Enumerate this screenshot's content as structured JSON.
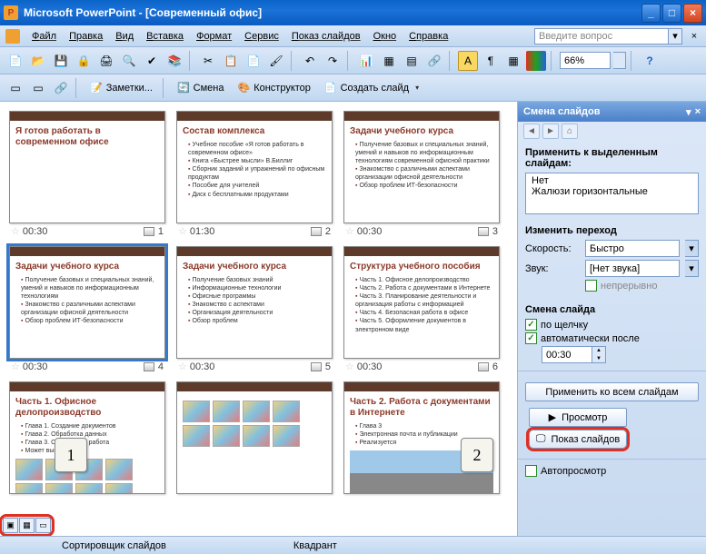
{
  "titlebar": {
    "text": "Microsoft PowerPoint - [Современный офис]"
  },
  "menu": {
    "items": [
      "Файл",
      "Правка",
      "Вид",
      "Вставка",
      "Формат",
      "Сервис",
      "Показ слайдов",
      "Окно",
      "Справка"
    ],
    "askbox_placeholder": "Введите вопрос"
  },
  "toolbar": {
    "zoom": "66%"
  },
  "toolbar2": {
    "notes": "Заметки...",
    "transition": "Смена",
    "design": "Конструктор",
    "newslide": "Создать слайд"
  },
  "slides": [
    {
      "time": "00:30",
      "num": "1",
      "title": "Я готов работать в современном офисе",
      "bullets": []
    },
    {
      "time": "01:30",
      "num": "2",
      "title": "Состав комплекса",
      "bullets": [
        "Учебное пособие «Я готов работать в современном офисе»",
        "Книга «Быстрее мысли» В.Биллиг",
        "Сборник заданий и упражнений по офисным продуктам",
        "Пособие для учителей",
        "Диск с бесплатными продуктами"
      ]
    },
    {
      "time": "00:30",
      "num": "3",
      "title": "Задачи учебного курса",
      "bullets": [
        "Получение базовых и специальных знаний, умений и навыков по информационным технологиям современной офисной практики",
        "Знакомство с различными аспектами организации офисной деятельности",
        "Обзор проблем ИТ-безопасности"
      ]
    },
    {
      "time": "00:30",
      "num": "4",
      "title": "Задачи учебного курса",
      "bullets": [
        "Получение базовых и специальных знаний, умений и навыков по информационным технологиям",
        "Знакомство с различными аспектами организации офисной деятельности",
        "Обзор проблем ИТ-безопасности"
      ],
      "selected": true
    },
    {
      "time": "00:30",
      "num": "5",
      "title": "Задачи учебного курса",
      "bullets": [
        "Получение базовых знаний",
        "Информационные технологии",
        "Офисные программы",
        "Знакомство с аспектами",
        "Организация деятельности",
        "Обзор проблем"
      ]
    },
    {
      "time": "00:30",
      "num": "6",
      "title": "Структура учебного пособия",
      "bullets": [
        "Часть 1. Офисное делопроизводство",
        "Часть 2. Работа с документами в Интернете",
        "Часть 3. Планирование деятельности и организация работы с информацией",
        "Часть 4. Безопасная работа в офисе",
        "Часть 5. Оформление документов в электронном виде"
      ]
    },
    {
      "time": "",
      "num": "",
      "title": "Часть 1. Офисное делопроизводство",
      "bullets": [
        "Глава 1. Создание документов",
        "Глава 2. Обработка данных",
        "Глава 3. Совместная работа",
        "Может выполняться"
      ],
      "gallery": true
    },
    {
      "time": "",
      "num": "",
      "title": "",
      "bullets": [],
      "gallery": true
    },
    {
      "time": "",
      "num": "",
      "title": "Часть 2. Работа с документами в Интернете",
      "bullets": [
        "Глава 3",
        "Электронная почта и публикации",
        "Реализуется"
      ],
      "road": true
    }
  ],
  "callouts": {
    "c1": "1",
    "c2": "2"
  },
  "taskpane": {
    "title": "Смена слайдов",
    "apply_label": "Применить к выделенным слайдам:",
    "effects": [
      "Нет",
      "Жалюзи горизонтальные"
    ],
    "modify_header": "Изменить переход",
    "speed_label": "Скорость:",
    "speed_value": "Быстро",
    "sound_label": "Звук:",
    "sound_value": "[Нет звука]",
    "loop_label": "непрерывно",
    "advance_header": "Смена слайда",
    "onclick_label": "по щелчку",
    "auto_label": "автоматически после",
    "auto_time": "00:30",
    "apply_all": "Применить ко всем слайдам",
    "preview": "Просмотр",
    "slideshow": "Показ слайдов",
    "autopreview": "Автопросмотр"
  },
  "statusbar": {
    "left": "Сортировщик слайдов",
    "mid": "Квадрант"
  }
}
